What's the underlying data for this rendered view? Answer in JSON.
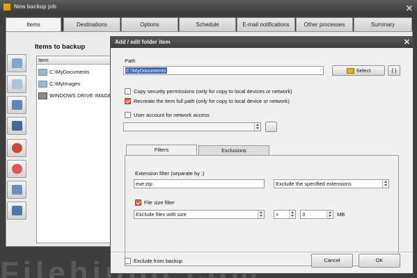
{
  "window": {
    "title": "New backup job"
  },
  "main_tabs": [
    {
      "label": "Items",
      "active": true
    },
    {
      "label": "Destinations",
      "active": false
    },
    {
      "label": "Options",
      "active": false
    },
    {
      "label": "Schedule",
      "active": false
    },
    {
      "label": "E-mail notifications",
      "active": false
    },
    {
      "label": "Other processes",
      "active": false
    },
    {
      "label": "Summary",
      "active": false
    }
  ],
  "items_panel": {
    "heading": "Items to backup",
    "column_header": "Item",
    "items": [
      {
        "label": "C:\\MyDocuments",
        "icon": "folder-icon"
      },
      {
        "label": "C:\\MyImages",
        "icon": "folder-icon"
      },
      {
        "label": "WINDOWS DRIVE IMAGE",
        "icon": "drive-image-icon"
      }
    ]
  },
  "toolbar_icons": [
    "add-folder-icon",
    "add-file-icon",
    "add-network-icon",
    "add-drive-image-icon",
    "add-sql-icon",
    "add-registry-icon",
    "edit-icon",
    "copy-icon"
  ],
  "dialog": {
    "title": "Add / edit folder item",
    "close_glyph": "✕",
    "path_label": "Path",
    "path_value": "C:\\MyDocuments",
    "select_label": "Select",
    "braces_label": "{ }",
    "copy_permissions": {
      "label": "Copy security permissions (only for copy to local devices or network)",
      "checked": false
    },
    "recreate_path": {
      "label": "Recreate the item full path (only for copy to local device or network)",
      "checked": true
    },
    "user_account": {
      "label": "User account for network access",
      "checked": false
    },
    "account_value": "",
    "subtabs": [
      {
        "label": "Filters",
        "active": true
      },
      {
        "label": "Exclusions",
        "active": false
      }
    ],
    "filters": {
      "extension_label": "Extension filter (separate by ;)",
      "extension_value": "exe;zip",
      "extension_mode": "Exclude the specified extensions",
      "file_size_filter": {
        "label": "File size filter",
        "checked": true
      },
      "size_mode": "Exclude files with size",
      "size_operator": ">",
      "size_value": "3",
      "size_unit": "MB"
    },
    "exclude_from_backup": {
      "label": "Exclude from backup",
      "checked": false
    },
    "cancel_label": "Cancel",
    "ok_label": "OK"
  },
  "watermark": "Filehippo.com",
  "colors": {
    "accent_checkbox": "#e8613a",
    "title_bar": "#3c3c3c",
    "selection": "#3a62c4"
  }
}
